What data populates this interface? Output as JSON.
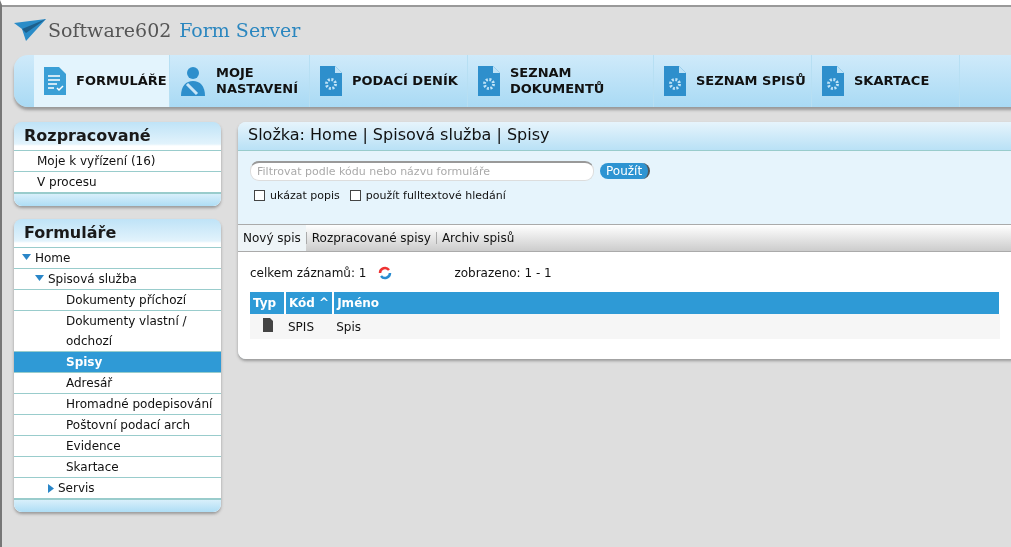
{
  "logo": {
    "brand": "Software602",
    "product": "Form Server"
  },
  "nav": [
    {
      "label": "FORMULÁŘE",
      "kind": "forms",
      "selected": true
    },
    {
      "label": "MOJE NASTAVENÍ",
      "kind": "user",
      "selected": false
    },
    {
      "label": "PODACÍ DENÍK",
      "kind": "gear-doc",
      "selected": false
    },
    {
      "label": "SEZNAM DOKUMENTŮ",
      "kind": "gear-doc",
      "selected": false
    },
    {
      "label": "SEZNAM SPISŮ",
      "kind": "gear-doc",
      "selected": false
    },
    {
      "label": "SKARTACE",
      "kind": "gear-doc",
      "selected": false
    }
  ],
  "in_progress": {
    "title": "Rozpracované",
    "items": [
      "Moje k vyřízení (16)",
      "V procesu"
    ]
  },
  "forms": {
    "title": "Formuláře",
    "tree": [
      {
        "label": "Home",
        "kind": "folder",
        "expanded": true,
        "selected": false,
        "children": [
          {
            "label": "Spisová služba",
            "kind": "folder",
            "expanded": true,
            "selected": false,
            "children": [
              {
                "label": "Dokumenty příchozí",
                "kind": "leaf",
                "selected": false
              },
              {
                "label": "Dokumenty vlastní / odchozí",
                "kind": "leaf",
                "selected": false
              },
              {
                "label": "Spisy",
                "kind": "leaf",
                "selected": true
              },
              {
                "label": "Adresář",
                "kind": "leaf",
                "selected": false
              },
              {
                "label": "Hromadné podepisování",
                "kind": "leaf",
                "selected": false
              },
              {
                "label": "Poštovní podací arch",
                "kind": "leaf",
                "selected": false
              },
              {
                "label": "Evidence",
                "kind": "leaf",
                "selected": false
              },
              {
                "label": "Skartace",
                "kind": "leaf",
                "selected": false
              },
              {
                "label": "Servis",
                "kind": "folder",
                "expanded": false,
                "selected": false
              }
            ]
          }
        ]
      }
    ]
  },
  "main": {
    "breadcrumb": "Složka: Home | Spisová služba | Spisy",
    "filter": {
      "placeholder": "Filtrovat podle kódu nebo názvu formuláře",
      "button": "Použít"
    },
    "options": [
      {
        "label": "ukázat popis",
        "checked": false
      },
      {
        "label": "použít fulltextové hledání",
        "checked": false
      }
    ],
    "tabs": [
      {
        "label": "Nový spis",
        "selected": true
      },
      {
        "label": "Rozpracované spisy",
        "selected": false
      },
      {
        "label": "Archiv spisů",
        "selected": false
      }
    ],
    "total": "celkem záznamů: 1",
    "shown": "zobrazeno: 1 - 1",
    "table": {
      "columns": [
        "Typ",
        "Kód ^",
        "Jméno"
      ],
      "rows": [
        {
          "code": "SPIS",
          "name": "Spis"
        }
      ]
    }
  }
}
